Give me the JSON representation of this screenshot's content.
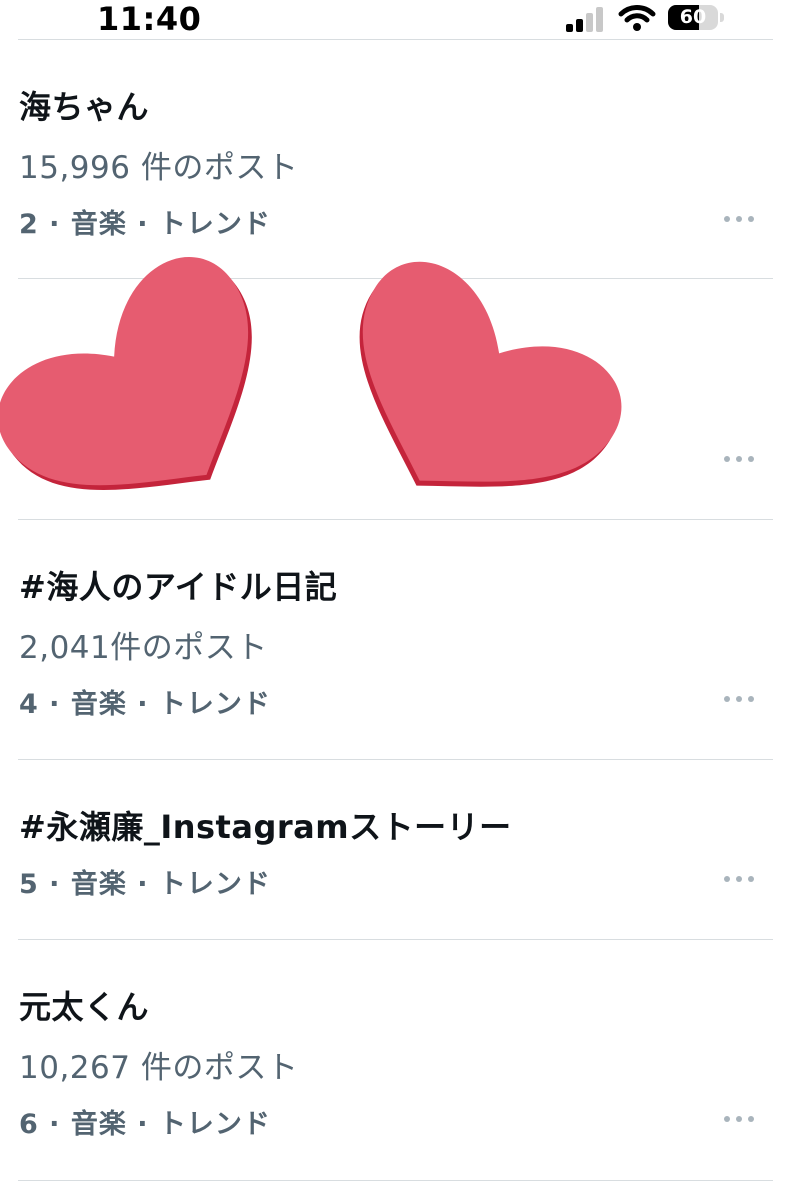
{
  "status": {
    "time": "11:40",
    "battery": "60"
  },
  "trends": [
    {
      "title": "海ちゃん",
      "count": "15,996 件のポスト",
      "meta": "2 · 音楽 · トレンド"
    },
    {
      "title": "",
      "count": "",
      "meta": ""
    },
    {
      "title": "#海人のアイドル日記",
      "count": "2,041件のポスト",
      "meta": "4 · 音楽 · トレンド"
    },
    {
      "title": "#永瀬廉_Instagramストーリー",
      "count": "",
      "meta": "5 · 音楽 · トレンド"
    },
    {
      "title": "元太くん",
      "count": "10,267 件のポスト",
      "meta": "6 · 音楽 · トレンド"
    }
  ],
  "overlay": {
    "icon": "heart-stickers",
    "color": "#e65c70",
    "shadow": "#c4243b"
  }
}
